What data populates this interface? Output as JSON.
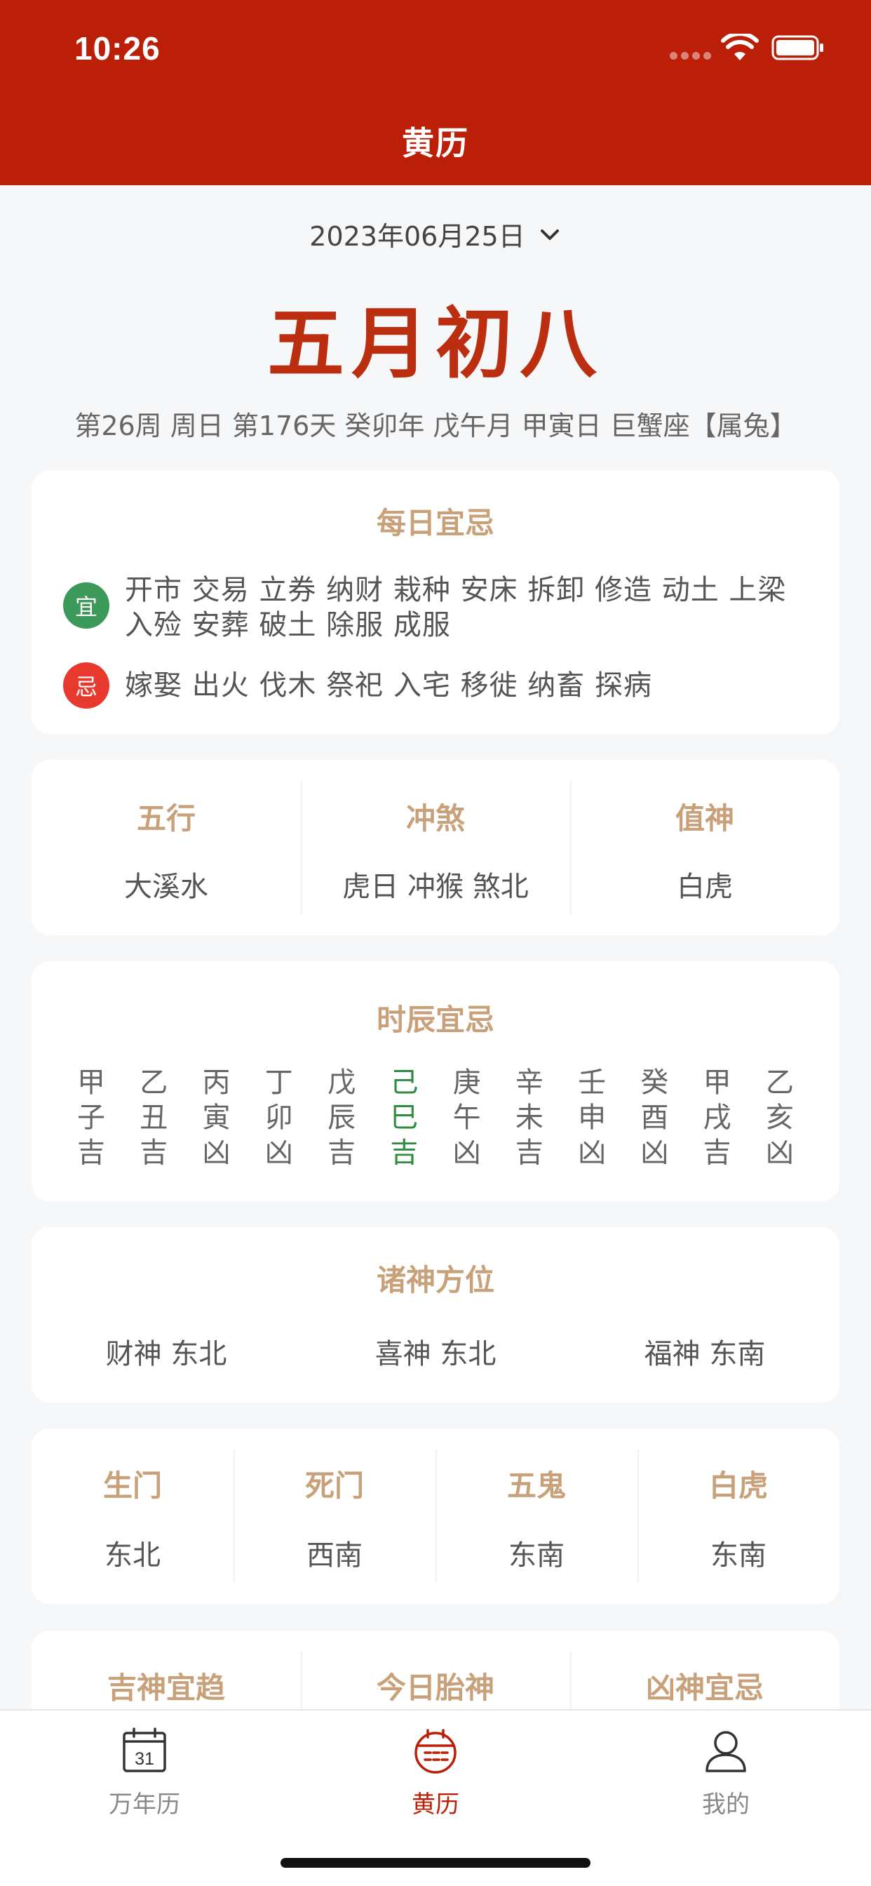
{
  "status_bar": {
    "time": "10:26"
  },
  "header": {
    "title": "黄历"
  },
  "date_picker": {
    "date": "2023年06月25日"
  },
  "lunar_date": "五月初八",
  "date_detail": "第26周 周日 第176天 癸卯年 戊午月 甲寅日 巨蟹座【属兔】",
  "daily_yiji": {
    "title": "每日宜忌",
    "yi_badge": "宜",
    "yi_text": "开市 交易 立券 纳财 栽种 安床 拆卸 修造 动土 上梁 入殓 安葬 破土 除服 成服",
    "ji_badge": "忌",
    "ji_text": "嫁娶 出火 伐木 祭祀 入宅 移徙 纳畜 探病"
  },
  "wuxing_card": {
    "cells": [
      {
        "title": "五行",
        "value": "大溪水"
      },
      {
        "title": "冲煞",
        "value": "虎日 冲猴 煞北"
      },
      {
        "title": "值神",
        "value": "白虎"
      }
    ]
  },
  "shichen_card": {
    "title": "时辰宜忌",
    "columns": [
      {
        "gan": "甲",
        "zhi": "子",
        "luck": "吉"
      },
      {
        "gan": "乙",
        "zhi": "丑",
        "luck": "吉"
      },
      {
        "gan": "丙",
        "zhi": "寅",
        "luck": "凶"
      },
      {
        "gan": "丁",
        "zhi": "卯",
        "luck": "凶"
      },
      {
        "gan": "戊",
        "zhi": "辰",
        "luck": "吉"
      },
      {
        "gan": "己",
        "zhi": "巳",
        "luck": "吉"
      },
      {
        "gan": "庚",
        "zhi": "午",
        "luck": "凶"
      },
      {
        "gan": "辛",
        "zhi": "未",
        "luck": "吉"
      },
      {
        "gan": "壬",
        "zhi": "申",
        "luck": "凶"
      },
      {
        "gan": "癸",
        "zhi": "酉",
        "luck": "凶"
      },
      {
        "gan": "甲",
        "zhi": "戌",
        "luck": "吉"
      },
      {
        "gan": "乙",
        "zhi": "亥",
        "luck": "凶"
      }
    ],
    "current_color": "#2e8b3f"
  },
  "zhushen_card": {
    "title": "诸神方位",
    "items": [
      "财神 东北",
      "喜神 东北",
      "福神 东南"
    ]
  },
  "men_card": {
    "cells": [
      {
        "title": "生门",
        "value": "东北"
      },
      {
        "title": "死门",
        "value": "西南"
      },
      {
        "title": "五鬼",
        "value": "东南"
      },
      {
        "title": "白虎",
        "value": "东南"
      }
    ]
  },
  "jishen_card": {
    "cells": [
      {
        "title": "吉神宜趋"
      },
      {
        "title": "今日胎神"
      },
      {
        "title": "凶神宜忌"
      }
    ]
  },
  "tab_bar": {
    "tabs": [
      {
        "label": "万年历",
        "icon": "calendar-31-icon",
        "icon_text": "31"
      },
      {
        "label": "黄历",
        "icon": "almanac-calendar-icon"
      },
      {
        "label": "我的",
        "icon": "person-icon"
      }
    ],
    "active_color": "#bb1f07"
  },
  "colors": {
    "header_bg": "#bb1f07",
    "accent_red": "#bb2e10",
    "card_title": "#c8a07a",
    "yi_green": "#3b9a5a",
    "ji_red": "#e8392f"
  }
}
